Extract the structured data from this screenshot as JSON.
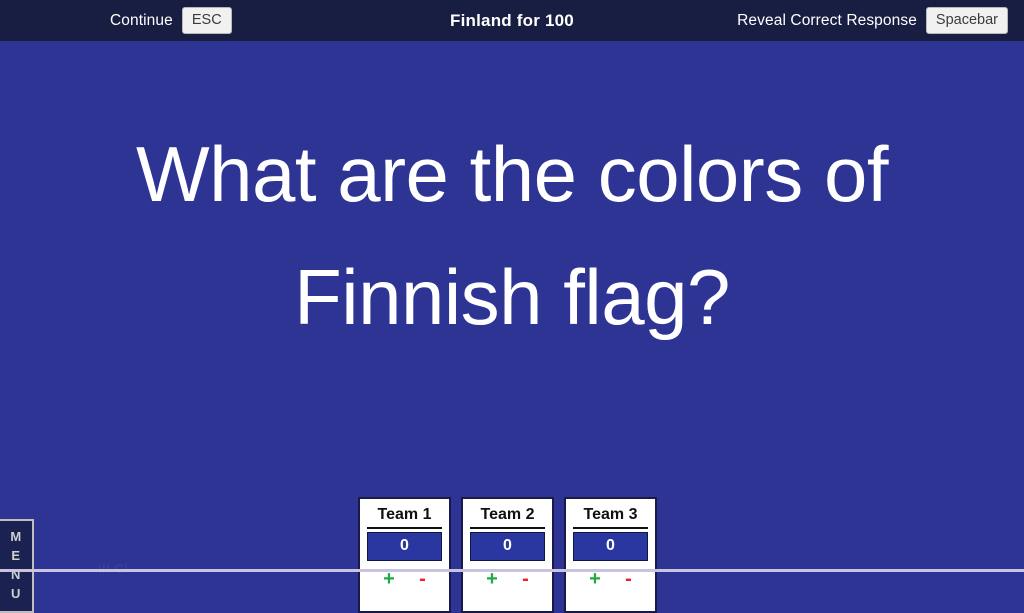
{
  "topbar": {
    "continue_label": "Continue",
    "continue_key": "ESC",
    "title": "Finland for 100",
    "reveal_label": "Reveal Correct Response",
    "reveal_key": "Spacebar",
    "background_color": "#181d42"
  },
  "stage": {
    "question": "What are the colors of\nFinnish flag?",
    "background_color": "#2d3494",
    "text_color": "#ffffff",
    "ghost_text": "ill Cl"
  },
  "menu_tab": {
    "label": "MENU",
    "letters": [
      "M",
      "E",
      "N",
      "U"
    ]
  },
  "teams": {
    "cards": [
      {
        "name": "Team 1",
        "score": "0",
        "plus": "+",
        "minus": "-"
      },
      {
        "name": "Team 2",
        "score": "0",
        "plus": "+",
        "minus": "-"
      },
      {
        "name": "Team 3",
        "score": "0",
        "plus": "+",
        "minus": "-"
      }
    ],
    "score_box_color": "#2a37a0",
    "plus_color": "#22aa44",
    "minus_color": "#ee2222"
  }
}
